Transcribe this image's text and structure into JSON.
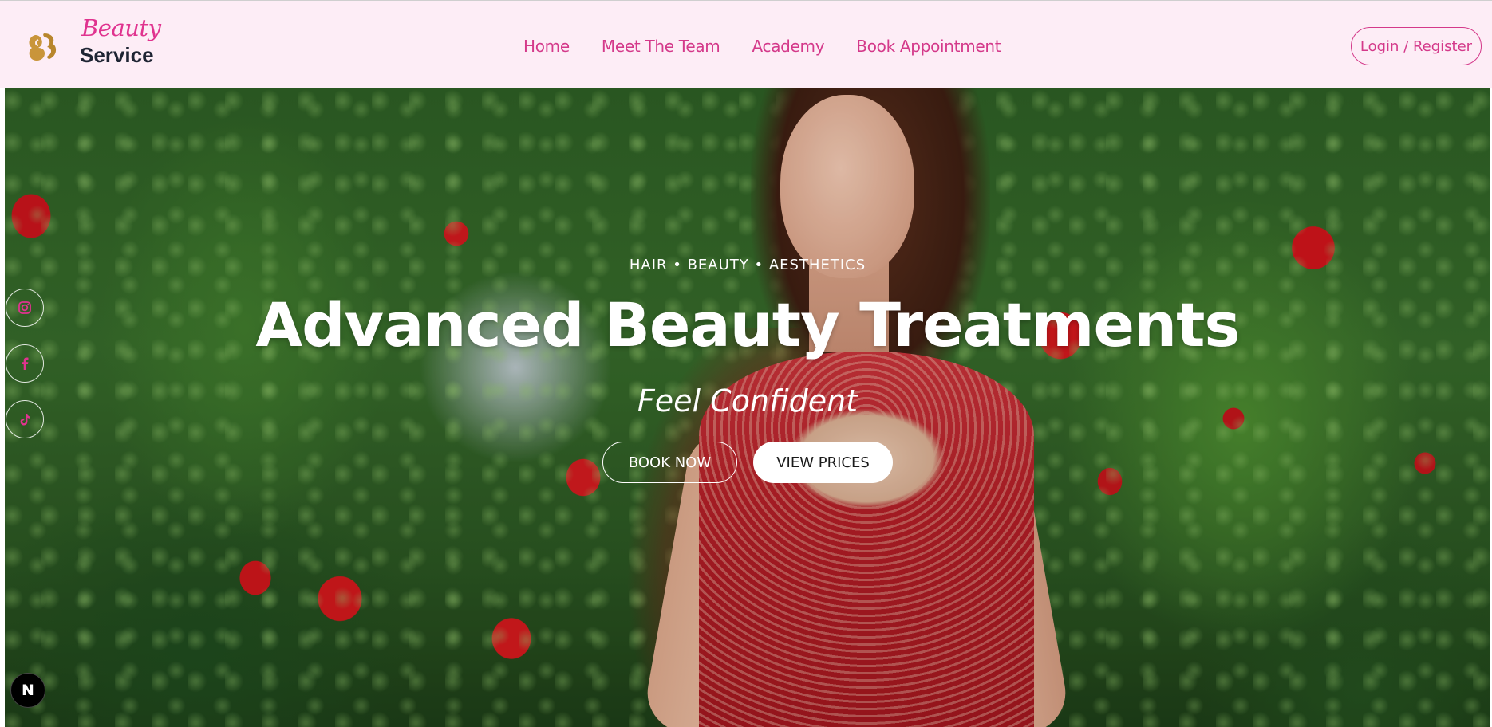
{
  "header": {
    "brand": {
      "script": "Beauty",
      "name": "Service"
    },
    "nav": [
      {
        "label": "Home"
      },
      {
        "label": "Meet The Team"
      },
      {
        "label": "Academy"
      },
      {
        "label": "Book Appointment"
      }
    ],
    "login_label": "Login / Register"
  },
  "hero": {
    "tagline": "HAIR • BEAUTY • AESTHETICS",
    "headline": "Advanced Beauty Treatments",
    "subhead": "Feel Confident",
    "book_label": "BOOK NOW",
    "prices_label": "VIEW PRICES"
  },
  "social": [
    {
      "icon": "instagram-icon"
    },
    {
      "icon": "facebook-icon"
    },
    {
      "icon": "tiktok-icon"
    }
  ],
  "dev_badge": {
    "label": "N"
  },
  "colors": {
    "accent": "#d4398a",
    "header_bg": "#fdedf6",
    "brand_dark": "#1e2433",
    "logo_gold": "#c9953a"
  }
}
